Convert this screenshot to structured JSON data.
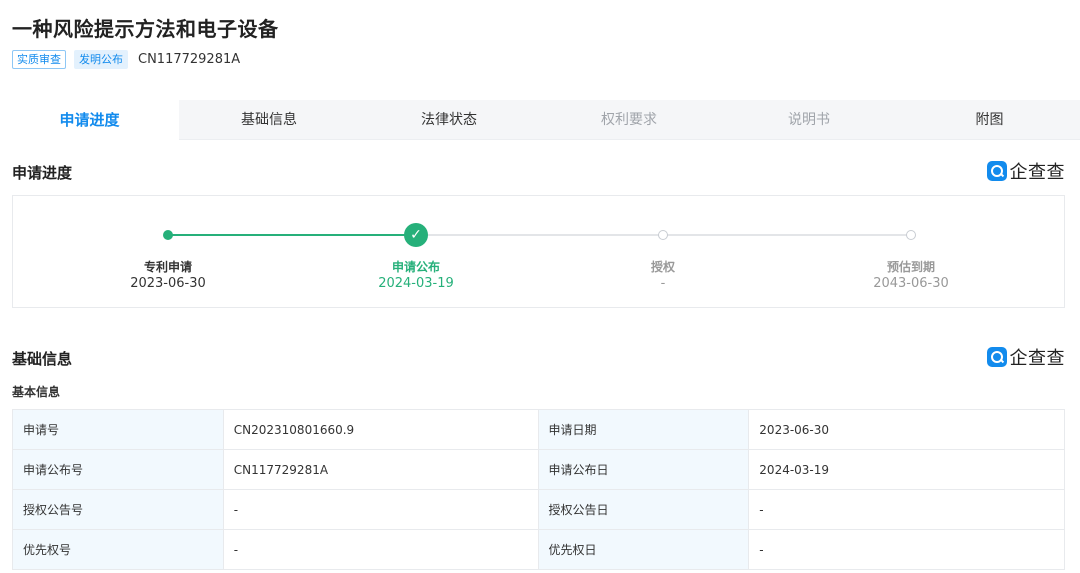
{
  "header": {
    "title": "一种风险提示方法和电子设备",
    "tags": [
      "实质审查",
      "发明公布"
    ],
    "publication_number": "CN117729281A"
  },
  "tabs": [
    {
      "label": "申请进度",
      "state": "active"
    },
    {
      "label": "基础信息",
      "state": "normal"
    },
    {
      "label": "法律状态",
      "state": "normal"
    },
    {
      "label": "权利要求",
      "state": "disabled"
    },
    {
      "label": "说明书",
      "state": "disabled"
    },
    {
      "label": "附图",
      "state": "normal"
    }
  ],
  "brand": {
    "name": "企查查",
    "icon": "qichacha-logo-icon",
    "color": "#128bed"
  },
  "progress": {
    "title": "申请进度",
    "steps": [
      {
        "label": "专利申请",
        "date": "2023-06-30",
        "status": "done"
      },
      {
        "label": "申请公布",
        "date": "2024-03-19",
        "status": "current"
      },
      {
        "label": "授权",
        "date": "-",
        "status": "future"
      },
      {
        "label": "预估到期",
        "date": "2043-06-30",
        "status": "future"
      }
    ],
    "colors": {
      "done": "#26b07a",
      "pending": "#e3e5e8"
    }
  },
  "basic": {
    "title": "基础信息",
    "subtitle": "基本信息",
    "rows": [
      [
        {
          "key": "申请号",
          "value": "CN202310801660.9"
        },
        {
          "key": "申请日期",
          "value": "2023-06-30"
        }
      ],
      [
        {
          "key": "申请公布号",
          "value": "CN117729281A"
        },
        {
          "key": "申请公布日",
          "value": "2024-03-19"
        }
      ],
      [
        {
          "key": "授权公告号",
          "value": "-"
        },
        {
          "key": "授权公告日",
          "value": "-"
        }
      ],
      [
        {
          "key": "优先权号",
          "value": "-"
        },
        {
          "key": "优先权日",
          "value": "-"
        }
      ]
    ]
  }
}
